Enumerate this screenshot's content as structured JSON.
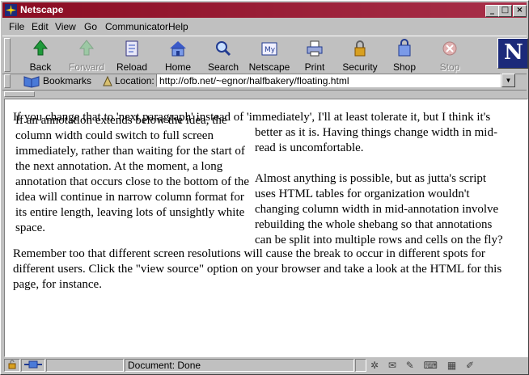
{
  "window": {
    "title": "Netscape"
  },
  "menu": [
    "File",
    "Edit",
    "View",
    "Go",
    "Communicator",
    "Help"
  ],
  "toolbar": [
    {
      "label": "Back",
      "icon": "back-arrow-icon",
      "enabled": true
    },
    {
      "label": "Forward",
      "icon": "forward-arrow-icon",
      "enabled": false
    },
    {
      "label": "Reload",
      "icon": "reload-icon",
      "enabled": true
    },
    {
      "label": "Home",
      "icon": "home-icon",
      "enabled": true
    },
    {
      "label": "Search",
      "icon": "search-icon",
      "enabled": true
    },
    {
      "label": "Netscape",
      "icon": "netscape-mail-icon",
      "enabled": true
    },
    {
      "label": "Print",
      "icon": "printer-icon",
      "enabled": true
    },
    {
      "label": "Security",
      "icon": "lock-icon",
      "enabled": true
    },
    {
      "label": "Shop",
      "icon": "shop-icon",
      "enabled": true
    },
    {
      "label": "Stop",
      "icon": "stop-icon",
      "enabled": false
    }
  ],
  "location": {
    "bookmarks_label": "Bookmarks",
    "location_label": "Location:",
    "url": "http://ofb.net/~egnor/halfbakery/floating.html"
  },
  "page": {
    "main_text": "If you change that to 'next paragraph' instead of 'immediately', I'll at least tolerate it, but I think it's",
    "left_column": "If an annotation extends below the idea, the column width could switch to full screen immediately, rather than waiting for the start of the next annotation. At the moment, a long annotation that occurs close to the bottom of the idea will continue in narrow column format for its entire length, leaving lots of unsightly white space.",
    "right_para_1": "better as it is. Having things change width in mid-read is uncomfortable.",
    "right_para_2": "Almost anything is possible, but as jutta's script uses HTML tables for organization wouldn't changing column width in mid-annotation involve rebuilding the whole shebang so that annotations can be split into multiple rows and cells on the fly?",
    "tail_text": "Remember too that different screen resolutions will cause the break to occur in different spots for different users. Click the \"view source\" option on your browser and take a look at the HTML for this page, for instance."
  },
  "status": {
    "text": "Document: Done"
  },
  "colors": {
    "titlebar": "#8a0c22",
    "chrome": "#c0c0c0",
    "content_bg": "#ffffff"
  }
}
